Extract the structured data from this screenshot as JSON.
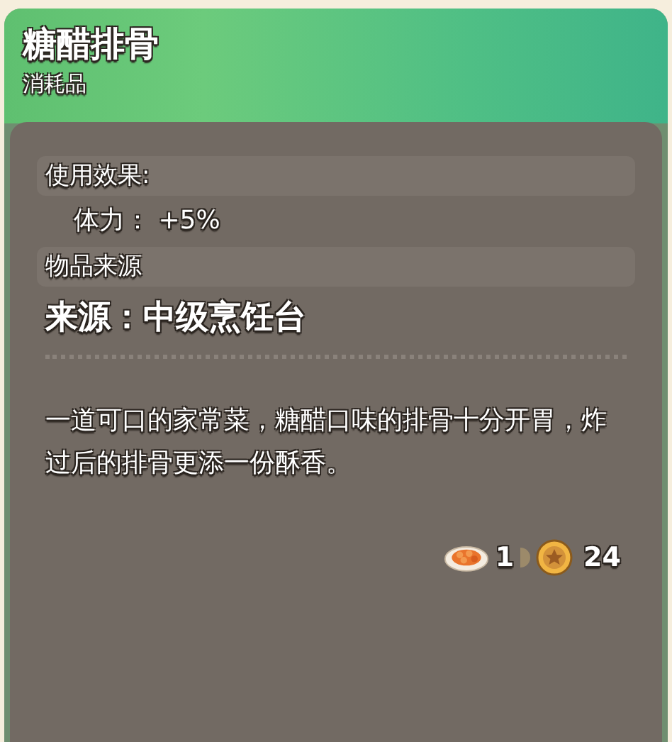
{
  "item": {
    "name": "糖醋排骨",
    "category": "消耗品"
  },
  "sections": [
    {
      "kind": "header",
      "text": "使用效果:"
    },
    {
      "kind": "stat",
      "text": "体力： +5%"
    },
    {
      "kind": "header",
      "text": "物品来源"
    },
    {
      "kind": "source",
      "text": "来源：中级烹饪台"
    }
  ],
  "description": "一道可口的家常菜，糖醋口味的排骨十分开胃，炸过后的排骨更添一份酥香。",
  "price": {
    "quantity": "1",
    "coins": "24"
  }
}
